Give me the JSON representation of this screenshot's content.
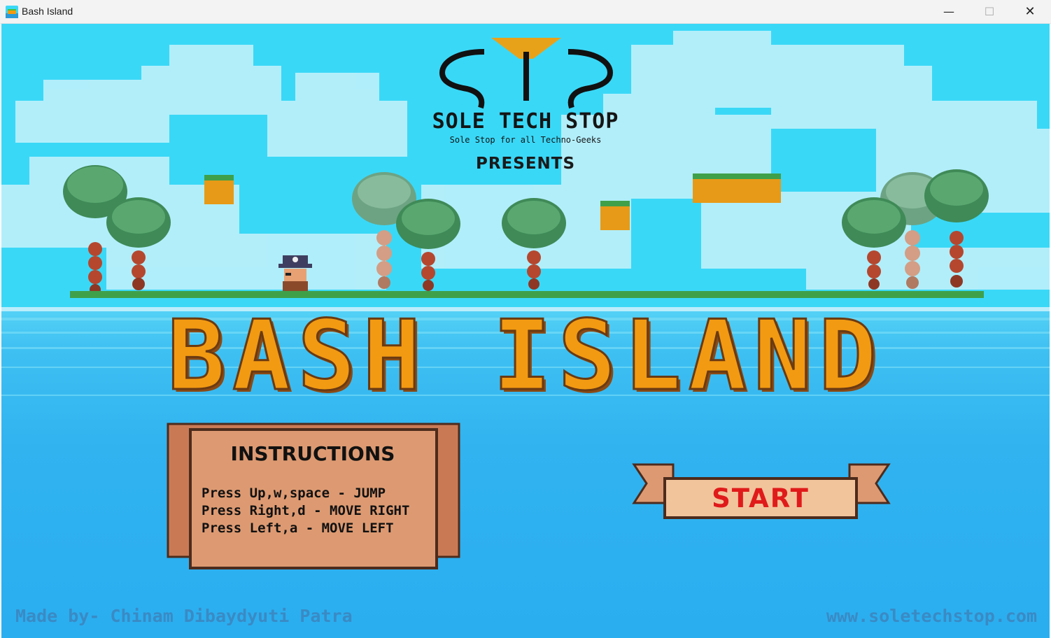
{
  "window": {
    "title": "Bash Island",
    "minimize_symbol": "—",
    "maximize_symbol": "☐",
    "close_symbol": "✕"
  },
  "logo": {
    "name": "SOLE TECH STOP",
    "tagline": "Sole Stop for all Techno-Geeks"
  },
  "presents": "PRESENTS",
  "game_title": "BASH ISLAND",
  "instructions": {
    "heading": "INSTRUCTIONS",
    "lines": [
      "Press Up,w,space - JUMP",
      "Press Right,d - MOVE RIGHT",
      "Press Left,a - MOVE LEFT"
    ]
  },
  "start_button": "START",
  "footer": {
    "credit": "Made by- Chinam Dibaydyuti Patra",
    "website": "www.soletechstop.com"
  },
  "colors": {
    "sky": "#3ad8f7",
    "sea": "#2aaef0",
    "title_orange": "#f29a12",
    "start_red": "#e01a1a",
    "scroll_parchment": "#dd9a72"
  }
}
